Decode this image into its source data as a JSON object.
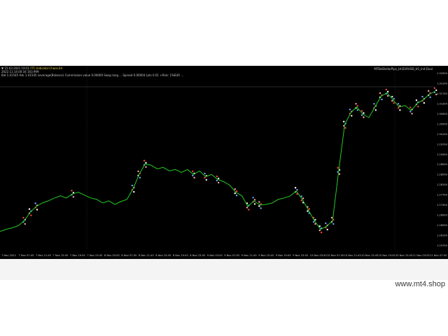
{
  "header": {
    "indicator_line": "15.03.2021 19:51",
    "indicator_label": "FTC.Indicator.Chaos.EA",
    "time_line": "2022.11.14 00:16 163.999",
    "params_line": "Bid 1.01545 Ask 1.01545 Leverage(Balance) Commission value 0.00000 Swap long ... Spread 0.00004 Lots 0.01 +Risk: 1%EUR ..."
  },
  "symbol_label": "MTBotDollarPips_LK-EURUSD_H1_Ind-Dual",
  "watermark": "www.mt4.shop",
  "colors": {
    "background": "#000000",
    "price_line": "#22cc22",
    "trade_markers": [
      "#ff4444",
      "#ffffff",
      "#6fa8ff",
      "#ffaaaa"
    ],
    "axis_text": "#c8c8c8",
    "grid": "#3a3a3a"
  },
  "y_axis": {
    "range": [
      1.1,
      1.35
    ],
    "labels": [
      "1.32500",
      "1.32100",
      "1.31700",
      "1.31300",
      "1.30900",
      "1.30500",
      "1.30100",
      "1.29700",
      "1.29300",
      "1.28900",
      "1.28500",
      "1.28100",
      "1.27700",
      "1.27300",
      "1.26900",
      "1.26500",
      "1.26100",
      "1.25700"
    ],
    "current_price": 1.34
  },
  "x_axis": {
    "labels": [
      "7 Nov 2022",
      "7 Nov 07:45",
      "7 Nov 11:45",
      "7 Nov 15:45",
      "7 Nov 19:45",
      "7 Nov 23:45",
      "8 Nov 03:45",
      "8 Nov 07:45",
      "8 Nov 11:45",
      "8 Nov 15:45",
      "8 Nov 19:45",
      "8 Nov 23:45",
      "9 Nov 03:45",
      "9 Nov 07:45",
      "9 Nov 11:45",
      "9 Nov 15:45",
      "9 Nov 19:45",
      "9 Nov 23:45",
      "10 Nov 03:45",
      "10 Nov 07:45",
      "10 Nov 11:45",
      "10 Nov 15:45",
      "10 Nov 19:45",
      "10 Nov 23:45",
      "11 Nov 03:45",
      "11 Nov 07:45"
    ]
  },
  "chart_data": {
    "type": "line",
    "series": [
      {
        "values": [
          1.125,
          1.128,
          1.13,
          1.133,
          1.14,
          1.152,
          1.16,
          1.165,
          1.168,
          1.172,
          1.175,
          1.172,
          1.178,
          1.18,
          1.176,
          1.172,
          1.17,
          1.165,
          1.168,
          1.163,
          1.167,
          1.17,
          1.185,
          1.205,
          1.22,
          1.218,
          1.213,
          1.215,
          1.21,
          1.212,
          1.208,
          1.212,
          1.205,
          1.21,
          1.202,
          1.205,
          1.198,
          1.195,
          1.19,
          1.18,
          1.175,
          1.16,
          1.168,
          1.162,
          1.163,
          1.165,
          1.17,
          1.172,
          1.175,
          1.182,
          1.17,
          1.155,
          1.14,
          1.128,
          1.132,
          1.14,
          1.21,
          1.275,
          1.292,
          1.3,
          1.29,
          1.285,
          1.3,
          1.315,
          1.32,
          1.31,
          1.3,
          1.302,
          1.295,
          1.305,
          1.31,
          1.318,
          1.322
        ]
      }
    ],
    "grid": false
  }
}
